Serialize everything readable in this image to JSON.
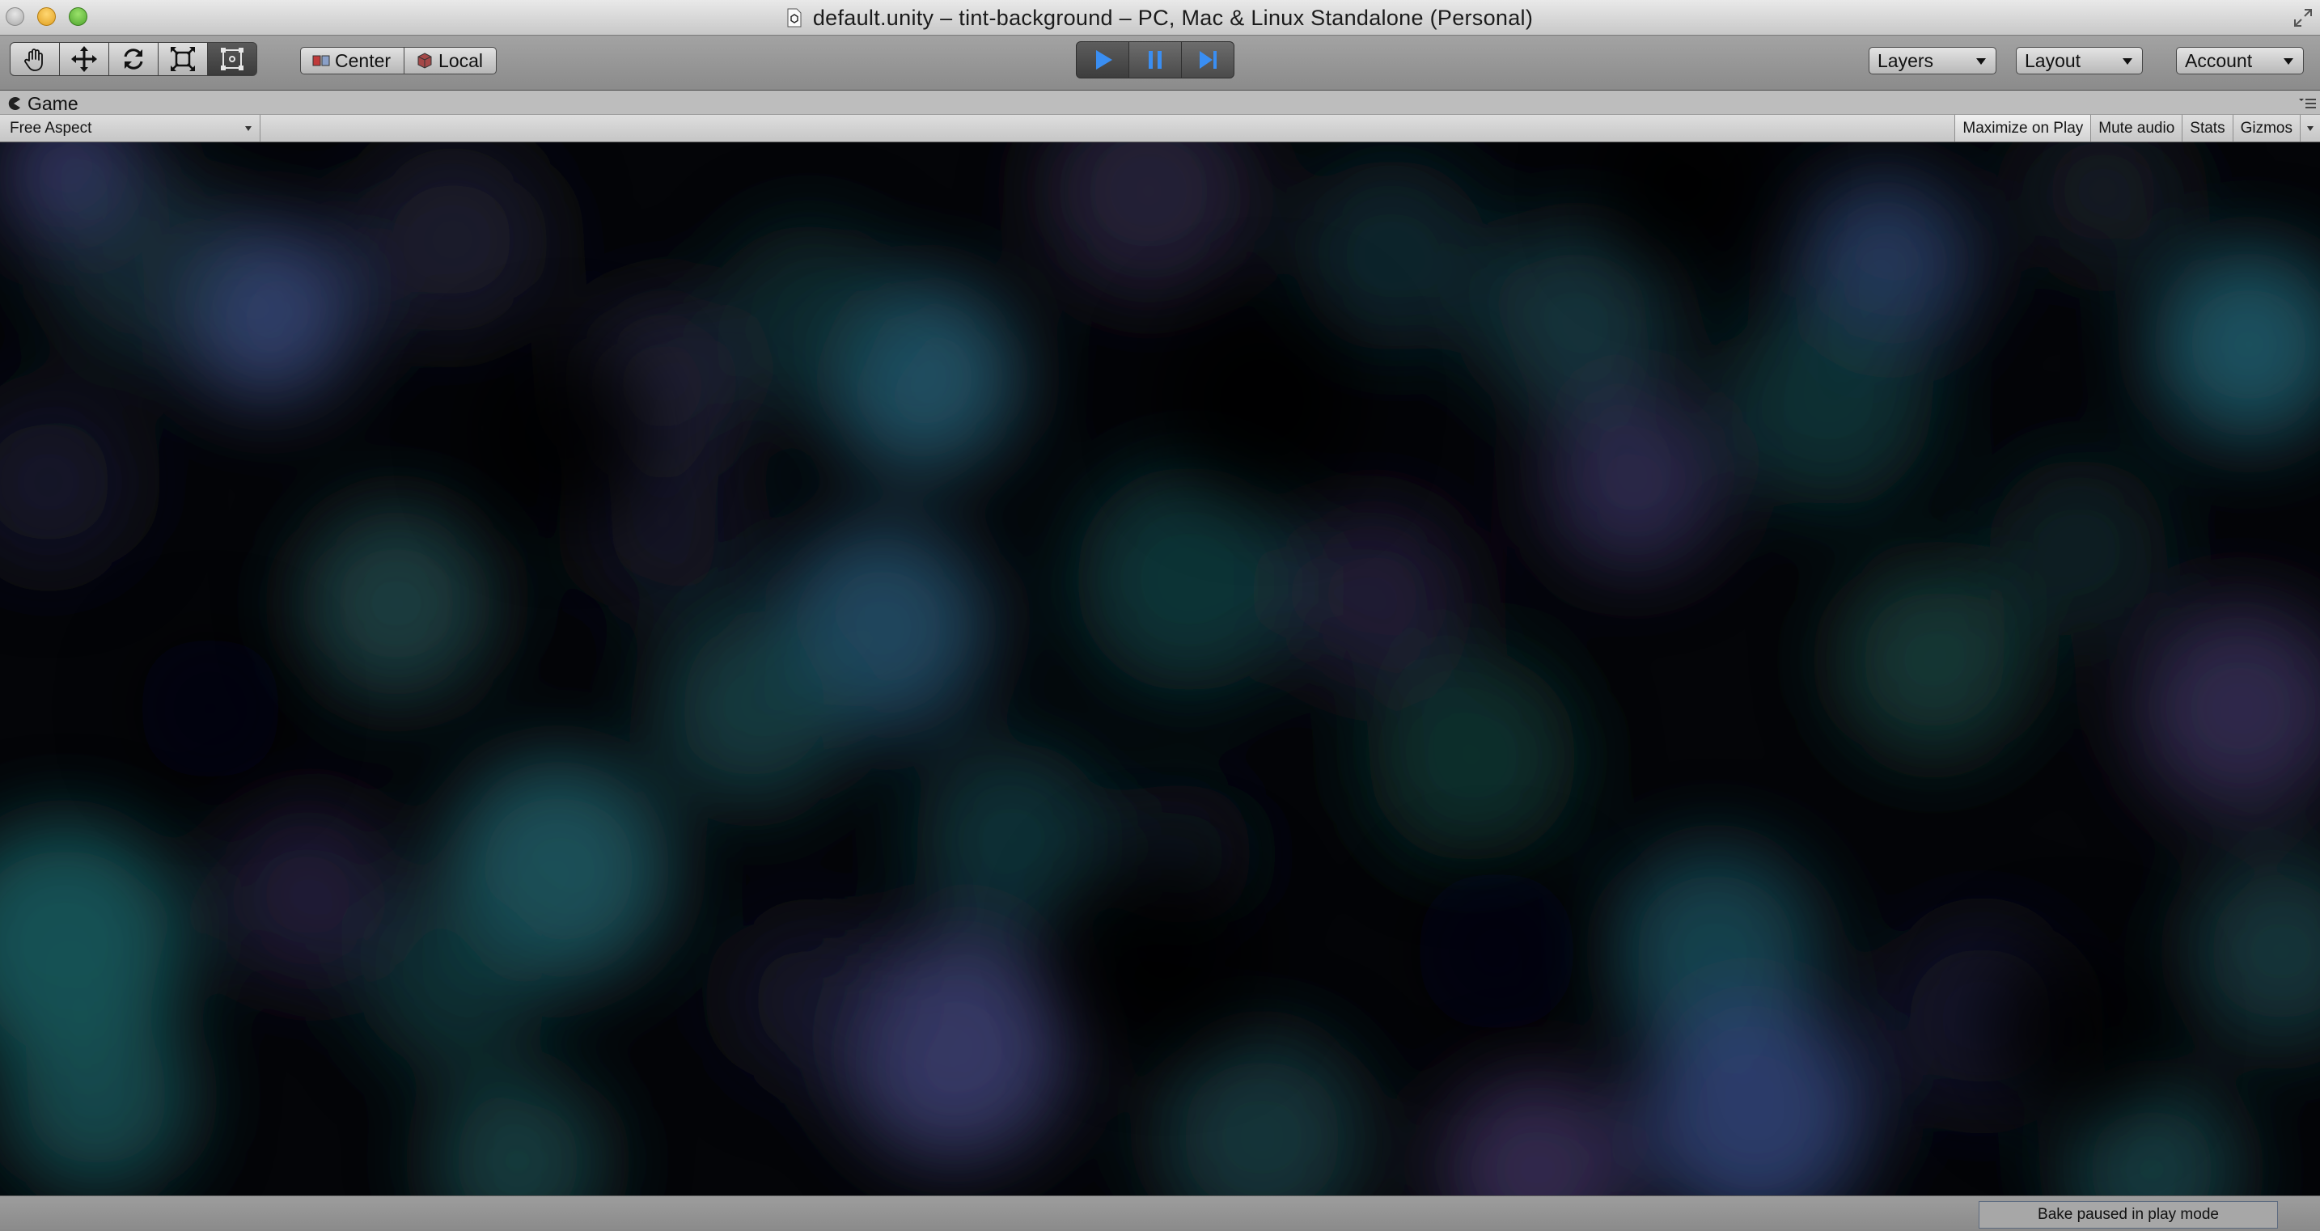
{
  "window": {
    "title": "default.unity – tint-background – PC, Mac & Linux Standalone (Personal)"
  },
  "toolbar": {
    "tools": [
      "hand-tool",
      "move-tool",
      "rotate-tool",
      "scale-tool",
      "rect-tool"
    ],
    "active_tool": "rect-tool",
    "pivot_mode_label": "Center",
    "pivot_rotation_label": "Local",
    "play_active": true,
    "layers_label": "Layers",
    "layout_label": "Layout",
    "account_label": "Account"
  },
  "game_tab": {
    "label": "Game",
    "aspect_label": "Free Aspect",
    "maximize_on_play_label": "Maximize on Play",
    "mute_audio_label": "Mute audio",
    "stats_label": "Stats",
    "gizmos_label": "Gizmos"
  },
  "colors": {
    "teal": "#1f5a5c",
    "indigo": "#3a3d6e",
    "purple": "#3b2f55",
    "background": "#040508",
    "play_blue": "#3a8ef2"
  },
  "status": {
    "bake_label": "Bake paused in play mode"
  }
}
